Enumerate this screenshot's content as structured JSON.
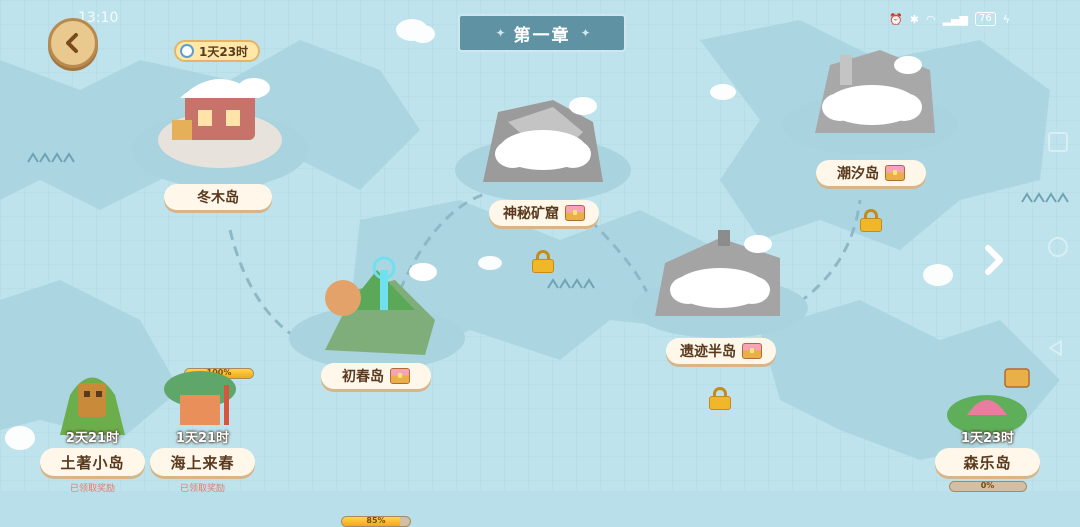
{
  "status_bar": {
    "time": "13:10",
    "battery": "76"
  },
  "header": {
    "chapter_title": "第一章"
  },
  "islands": [
    {
      "name": "冬木岛",
      "progress_text": "100%",
      "progress": 1.0,
      "timer": "1天23时",
      "locked": false,
      "chest": false
    },
    {
      "name": "初春岛",
      "progress_text": "85%",
      "progress": 0.85,
      "locked": false,
      "chest": true
    },
    {
      "name": "神秘矿窟",
      "locked": true,
      "chest": true
    },
    {
      "name": "遗迹半岛",
      "locked": true,
      "chest": true
    },
    {
      "name": "潮汐岛",
      "locked": true,
      "chest": true
    }
  ],
  "events": [
    {
      "name": "土著小岛",
      "timer": "2天21时",
      "status": "已领取奖励"
    },
    {
      "name": "海上来春",
      "timer": "1天21时",
      "status": "已领取奖励"
    },
    {
      "name": "森乐岛",
      "timer": "1天23时",
      "progress_text": "0%",
      "progress": 0.0
    }
  ],
  "colors": {
    "sea": "#b9e0ea",
    "label_bg": "#fff7ea",
    "label_text": "#5a3a1e",
    "chapter_banner": "#5f93a4"
  }
}
